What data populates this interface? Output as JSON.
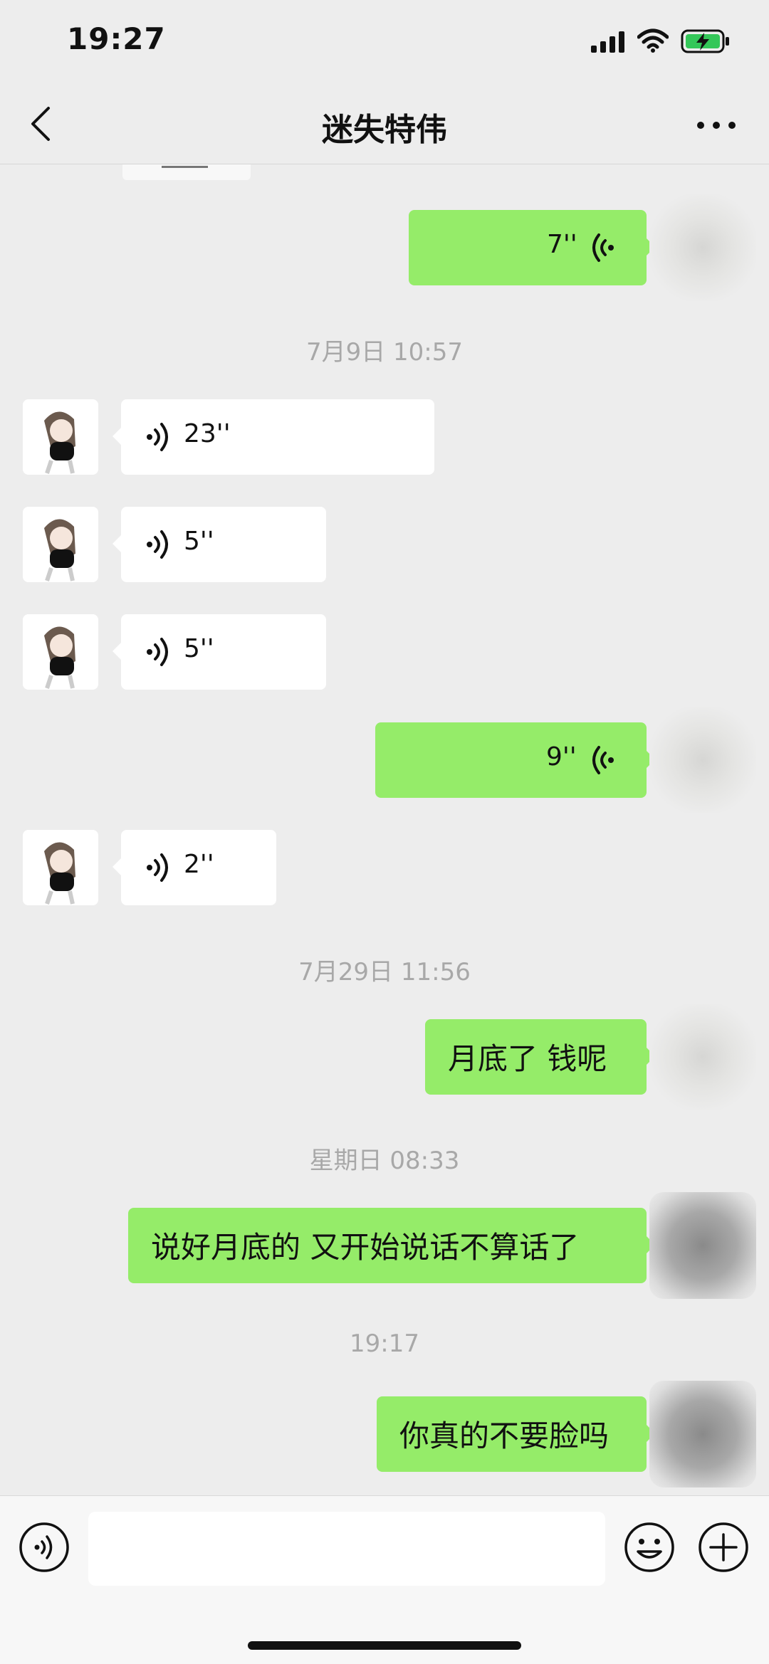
{
  "status_bar": {
    "time": "19:27",
    "battery_state": "charging",
    "battery_color": "#34c759"
  },
  "header": {
    "title": "迷失特伟"
  },
  "messages": {
    "m1": {
      "direction": "outgoing",
      "type": "voice",
      "duration": "7''"
    },
    "ts1": "7月9日 10:57",
    "m2": {
      "direction": "incoming",
      "type": "voice",
      "duration": "23''"
    },
    "m3": {
      "direction": "incoming",
      "type": "voice",
      "duration": "5''"
    },
    "m4": {
      "direction": "incoming",
      "type": "voice",
      "duration": "5''"
    },
    "m5": {
      "direction": "outgoing",
      "type": "voice",
      "duration": "9''"
    },
    "m6": {
      "direction": "incoming",
      "type": "voice",
      "duration": "2''"
    },
    "ts2": "7月29日 11:56",
    "m7": {
      "direction": "outgoing",
      "type": "text",
      "text": "月底了  钱呢"
    },
    "ts3": "星期日 08:33",
    "m8": {
      "direction": "outgoing",
      "type": "text",
      "text": "说好月底的   又开始说话不算话了"
    },
    "ts4": "19:17",
    "m9": {
      "direction": "outgoing",
      "type": "text",
      "text": "你真的不要脸吗"
    }
  },
  "input_bar": {
    "value": "",
    "placeholder": ""
  },
  "colors": {
    "outgoing_bubble": "#95ec69",
    "incoming_bubble": "#ffffff",
    "background": "#ededed"
  }
}
